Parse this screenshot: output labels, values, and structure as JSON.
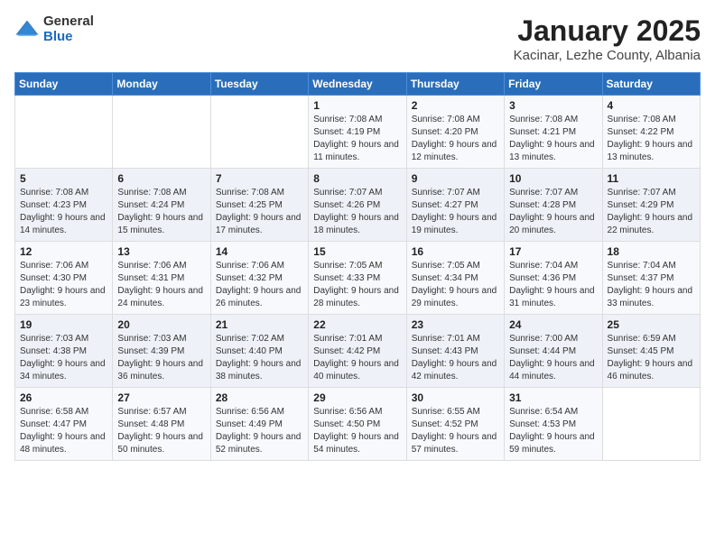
{
  "logo": {
    "general": "General",
    "blue": "Blue"
  },
  "header": {
    "title": "January 2025",
    "location": "Kacinar, Lezhe County, Albania"
  },
  "weekdays": [
    "Sunday",
    "Monday",
    "Tuesday",
    "Wednesday",
    "Thursday",
    "Friday",
    "Saturday"
  ],
  "weeks": [
    [
      {
        "day": "",
        "sunrise": "",
        "sunset": "",
        "daylight": ""
      },
      {
        "day": "",
        "sunrise": "",
        "sunset": "",
        "daylight": ""
      },
      {
        "day": "",
        "sunrise": "",
        "sunset": "",
        "daylight": ""
      },
      {
        "day": "1",
        "sunrise": "7:08 AM",
        "sunset": "4:19 PM",
        "daylight": "9 hours and 11 minutes."
      },
      {
        "day": "2",
        "sunrise": "7:08 AM",
        "sunset": "4:20 PM",
        "daylight": "9 hours and 12 minutes."
      },
      {
        "day": "3",
        "sunrise": "7:08 AM",
        "sunset": "4:21 PM",
        "daylight": "9 hours and 13 minutes."
      },
      {
        "day": "4",
        "sunrise": "7:08 AM",
        "sunset": "4:22 PM",
        "daylight": "9 hours and 13 minutes."
      }
    ],
    [
      {
        "day": "5",
        "sunrise": "7:08 AM",
        "sunset": "4:23 PM",
        "daylight": "9 hours and 14 minutes."
      },
      {
        "day": "6",
        "sunrise": "7:08 AM",
        "sunset": "4:24 PM",
        "daylight": "9 hours and 15 minutes."
      },
      {
        "day": "7",
        "sunrise": "7:08 AM",
        "sunset": "4:25 PM",
        "daylight": "9 hours and 17 minutes."
      },
      {
        "day": "8",
        "sunrise": "7:07 AM",
        "sunset": "4:26 PM",
        "daylight": "9 hours and 18 minutes."
      },
      {
        "day": "9",
        "sunrise": "7:07 AM",
        "sunset": "4:27 PM",
        "daylight": "9 hours and 19 minutes."
      },
      {
        "day": "10",
        "sunrise": "7:07 AM",
        "sunset": "4:28 PM",
        "daylight": "9 hours and 20 minutes."
      },
      {
        "day": "11",
        "sunrise": "7:07 AM",
        "sunset": "4:29 PM",
        "daylight": "9 hours and 22 minutes."
      }
    ],
    [
      {
        "day": "12",
        "sunrise": "7:06 AM",
        "sunset": "4:30 PM",
        "daylight": "9 hours and 23 minutes."
      },
      {
        "day": "13",
        "sunrise": "7:06 AM",
        "sunset": "4:31 PM",
        "daylight": "9 hours and 24 minutes."
      },
      {
        "day": "14",
        "sunrise": "7:06 AM",
        "sunset": "4:32 PM",
        "daylight": "9 hours and 26 minutes."
      },
      {
        "day": "15",
        "sunrise": "7:05 AM",
        "sunset": "4:33 PM",
        "daylight": "9 hours and 28 minutes."
      },
      {
        "day": "16",
        "sunrise": "7:05 AM",
        "sunset": "4:34 PM",
        "daylight": "9 hours and 29 minutes."
      },
      {
        "day": "17",
        "sunrise": "7:04 AM",
        "sunset": "4:36 PM",
        "daylight": "9 hours and 31 minutes."
      },
      {
        "day": "18",
        "sunrise": "7:04 AM",
        "sunset": "4:37 PM",
        "daylight": "9 hours and 33 minutes."
      }
    ],
    [
      {
        "day": "19",
        "sunrise": "7:03 AM",
        "sunset": "4:38 PM",
        "daylight": "9 hours and 34 minutes."
      },
      {
        "day": "20",
        "sunrise": "7:03 AM",
        "sunset": "4:39 PM",
        "daylight": "9 hours and 36 minutes."
      },
      {
        "day": "21",
        "sunrise": "7:02 AM",
        "sunset": "4:40 PM",
        "daylight": "9 hours and 38 minutes."
      },
      {
        "day": "22",
        "sunrise": "7:01 AM",
        "sunset": "4:42 PM",
        "daylight": "9 hours and 40 minutes."
      },
      {
        "day": "23",
        "sunrise": "7:01 AM",
        "sunset": "4:43 PM",
        "daylight": "9 hours and 42 minutes."
      },
      {
        "day": "24",
        "sunrise": "7:00 AM",
        "sunset": "4:44 PM",
        "daylight": "9 hours and 44 minutes."
      },
      {
        "day": "25",
        "sunrise": "6:59 AM",
        "sunset": "4:45 PM",
        "daylight": "9 hours and 46 minutes."
      }
    ],
    [
      {
        "day": "26",
        "sunrise": "6:58 AM",
        "sunset": "4:47 PM",
        "daylight": "9 hours and 48 minutes."
      },
      {
        "day": "27",
        "sunrise": "6:57 AM",
        "sunset": "4:48 PM",
        "daylight": "9 hours and 50 minutes."
      },
      {
        "day": "28",
        "sunrise": "6:56 AM",
        "sunset": "4:49 PM",
        "daylight": "9 hours and 52 minutes."
      },
      {
        "day": "29",
        "sunrise": "6:56 AM",
        "sunset": "4:50 PM",
        "daylight": "9 hours and 54 minutes."
      },
      {
        "day": "30",
        "sunrise": "6:55 AM",
        "sunset": "4:52 PM",
        "daylight": "9 hours and 57 minutes."
      },
      {
        "day": "31",
        "sunrise": "6:54 AM",
        "sunset": "4:53 PM",
        "daylight": "9 hours and 59 minutes."
      },
      {
        "day": "",
        "sunrise": "",
        "sunset": "",
        "daylight": ""
      }
    ]
  ]
}
